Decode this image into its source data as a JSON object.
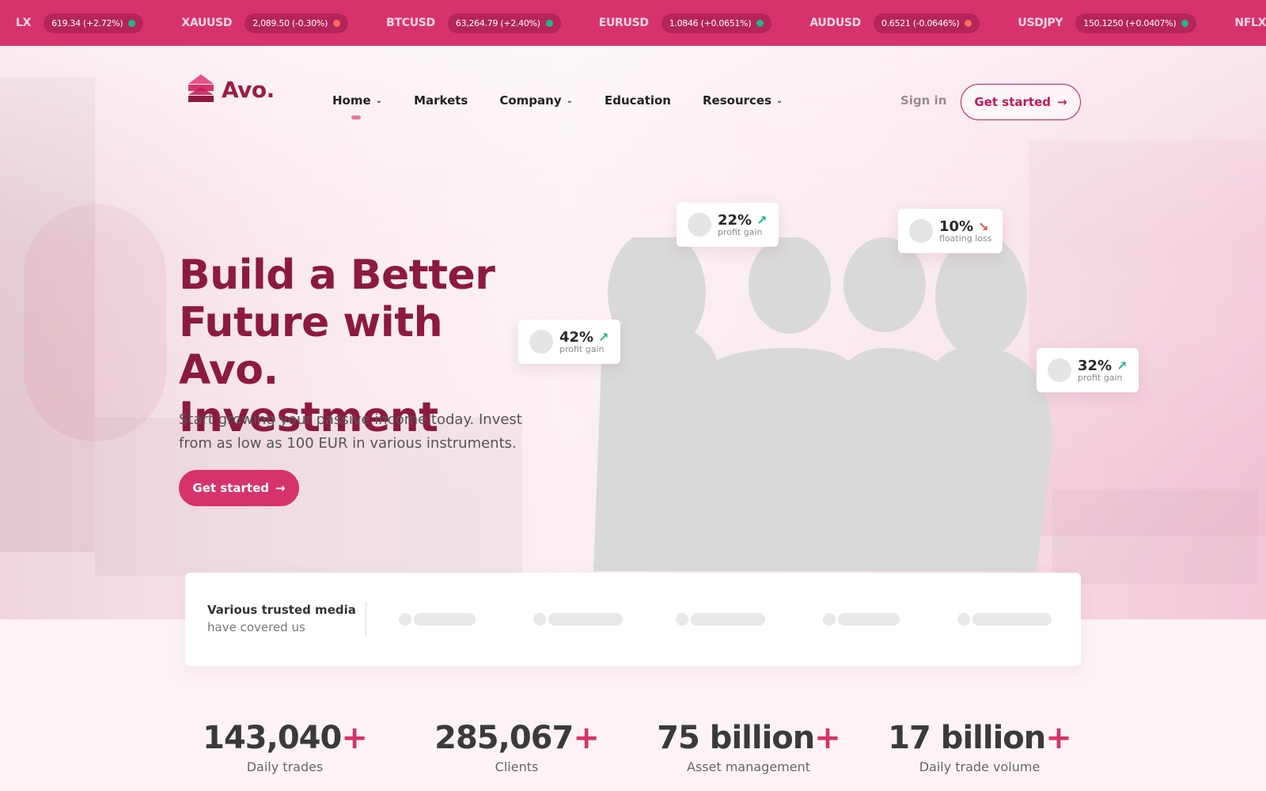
{
  "ticker": [
    {
      "symbol": "LX",
      "value": "619.34 (+2.72%)",
      "dir": "up"
    },
    {
      "symbol": "XAUUSD",
      "value": "2,089.50 (-0.30%)",
      "dir": "down"
    },
    {
      "symbol": "BTCUSD",
      "value": "63,264.79 (+2.40%)",
      "dir": "up"
    },
    {
      "symbol": "EURUSD",
      "value": "1.0846 (+0.0651%)",
      "dir": "up"
    },
    {
      "symbol": "AUDUSD",
      "value": "0.6521 (-0.0646%)",
      "dir": "down"
    },
    {
      "symbol": "USDJPY",
      "value": "150.1250 (+0.0407%)",
      "dir": "up"
    },
    {
      "symbol": "NFLX",
      "value": "",
      "dir": "up"
    }
  ],
  "colors": {
    "up": "#20b887",
    "down": "#ff6b5a",
    "accent": "#d6336c",
    "brand": "#8c1a3f"
  },
  "logo": {
    "text": "Avo."
  },
  "nav": {
    "items": [
      {
        "label": "Home",
        "chevron": true,
        "active": true
      },
      {
        "label": "Markets",
        "chevron": false
      },
      {
        "label": "Company",
        "chevron": true
      },
      {
        "label": "Education",
        "chevron": false
      },
      {
        "label": "Resources",
        "chevron": true
      }
    ],
    "sign_in": "Sign in",
    "cta": "Get started"
  },
  "hero": {
    "title_line1": "Build a Better",
    "title_line2": "Future with Avo.",
    "title_line3": "Investment",
    "subtitle": "Start growing your passive income today. Invest from as low as 100 EUR in various instruments.",
    "cta": "Get started"
  },
  "cards": [
    {
      "pct": "22%",
      "label": "profit gain",
      "trend": "up"
    },
    {
      "pct": "10%",
      "label": "floating loss",
      "trend": "down"
    },
    {
      "pct": "42%",
      "label": "profit gain",
      "trend": "up"
    },
    {
      "pct": "32%",
      "label": "profit gain",
      "trend": "up"
    }
  ],
  "media": {
    "title": "Various trusted media",
    "subtitle": "have covered us"
  },
  "stats": [
    {
      "value": "143,040",
      "label": "Daily trades"
    },
    {
      "value": "285,067",
      "label": "Clients"
    },
    {
      "value": "75 billion",
      "label": "Asset management"
    },
    {
      "value": "17 billion",
      "label": "Daily trade volume"
    }
  ]
}
